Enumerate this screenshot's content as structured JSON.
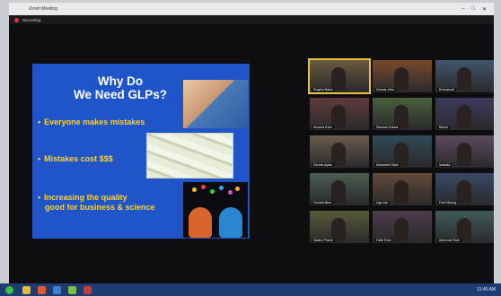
{
  "window": {
    "title": "Zoom Meeting",
    "recording_label": "Recording",
    "controls": [
      "–",
      "□",
      "✕"
    ]
  },
  "slide": {
    "title_line1": "Why Do",
    "title_line2": "We Need GLPs?",
    "bullets": [
      "Everyone makes mistakes",
      "Mistakes cost $$$",
      "Increasing the quality",
      "good for business & science"
    ],
    "background_color": "#1f55c9",
    "bullet_color": "#ffd22e"
  },
  "participants": [
    {
      "name": "Rogers Bakor",
      "active": true
    },
    {
      "name": "Dorcas John",
      "active": false
    },
    {
      "name": "Emmanuel",
      "active": false
    },
    {
      "name": "Anusua Kaur",
      "active": false
    },
    {
      "name": "Samson Kaduk",
      "active": false
    },
    {
      "name": "Birkhe",
      "active": false
    },
    {
      "name": "Dennis Ayole",
      "active": false
    },
    {
      "name": "Mohamed Salih",
      "active": false
    },
    {
      "name": "Iwatuka",
      "active": false
    },
    {
      "name": "Gomba Bero",
      "active": false
    },
    {
      "name": "Ugo Ida",
      "active": false
    },
    {
      "name": "Fred Mirang",
      "active": false
    },
    {
      "name": "Sadhu Phanit",
      "active": false
    },
    {
      "name": "Faith Ruto",
      "active": false
    },
    {
      "name": "Ambrose Rubi",
      "active": false
    }
  ],
  "taskbar": {
    "clock": "11:45 AM"
  }
}
